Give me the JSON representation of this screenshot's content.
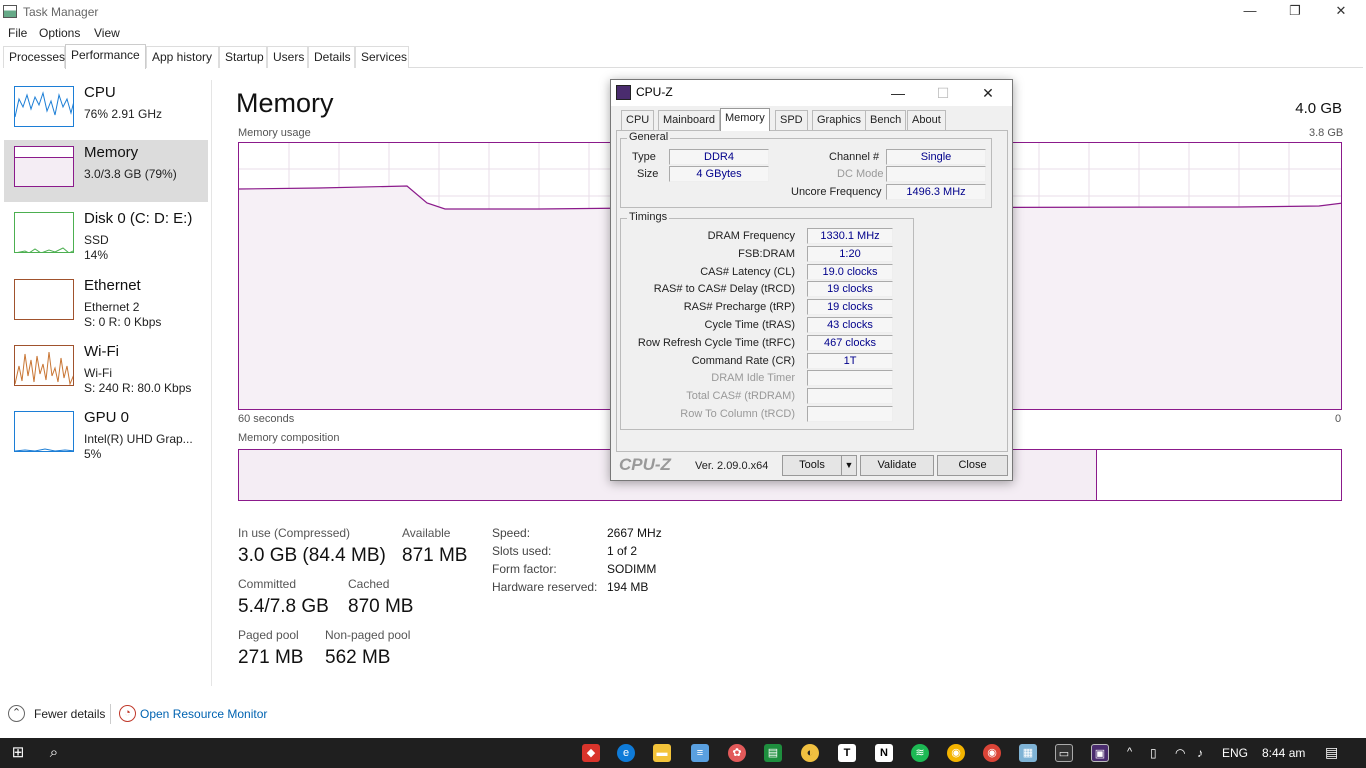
{
  "window": {
    "title": "Task Manager",
    "min": "—",
    "max": "❐",
    "close": "✕"
  },
  "menu": [
    "File",
    "Options",
    "View"
  ],
  "tabs": [
    "Processes",
    "Performance",
    "App history",
    "Startup",
    "Users",
    "Details",
    "Services"
  ],
  "sidebar": [
    {
      "name": "CPU",
      "sub1": "76%  2.91 GHz",
      "sub2": "",
      "sub3": "",
      "color": "#1c7ed6"
    },
    {
      "name": "Memory",
      "sub1": "3.0/3.8 GB (79%)",
      "sub2": "",
      "sub3": "",
      "color": "#8b1a8b"
    },
    {
      "name": "Disk 0 (C: D: E:)",
      "sub1": "SSD",
      "sub2": "14%",
      "sub3": "",
      "color": "#4caf50"
    },
    {
      "name": "Ethernet",
      "sub1": "Ethernet 2",
      "sub2": "S: 0 R: 0 Kbps",
      "sub3": "",
      "color": "#a0522d"
    },
    {
      "name": "Wi-Fi",
      "sub1": "Wi-Fi",
      "sub2": "S: 240 R: 80.0 Kbps",
      "sub3": "",
      "color": "#a0522d"
    },
    {
      "name": "GPU 0",
      "sub1": "Intel(R) UHD Grap...",
      "sub2": "5%",
      "sub3": "",
      "color": "#1c7ed6"
    }
  ],
  "main": {
    "title": "Memory",
    "total": "4.0 GB",
    "usage_label": "Memory usage",
    "usage_max": "3.8 GB",
    "time_label": "60 seconds",
    "zero": "0",
    "composition_label": "Memory composition",
    "stats": {
      "in_use_label": "In use (Compressed)",
      "in_use": "3.0 GB (84.4 MB)",
      "available_label": "Available",
      "available": "871 MB",
      "committed_label": "Committed",
      "committed": "5.4/7.8 GB",
      "cached_label": "Cached",
      "cached": "870 MB",
      "paged_label": "Paged pool",
      "paged": "271 MB",
      "nonpaged_label": "Non-paged pool",
      "nonpaged": "562 MB"
    },
    "details": [
      {
        "label": "Speed:",
        "value": "2667 MHz"
      },
      {
        "label": "Slots used:",
        "value": "1 of 2"
      },
      {
        "label": "Form factor:",
        "value": "SODIMM"
      },
      {
        "label": "Hardware reserved:",
        "value": "194 MB"
      }
    ]
  },
  "footer": {
    "fewer": "Fewer details",
    "resmon": "Open Resource Monitor"
  },
  "cpuz": {
    "title": "CPU-Z",
    "tabs": [
      "CPU",
      "Mainboard",
      "Memory",
      "SPD",
      "Graphics",
      "Bench",
      "About"
    ],
    "general_title": "General",
    "type_label": "Type",
    "type": "DDR4",
    "size_label": "Size",
    "size": "4 GBytes",
    "channel_label": "Channel #",
    "channel": "Single",
    "dcmode_label": "DC Mode",
    "dcmode": "",
    "uncore_label": "Uncore Frequency",
    "uncore": "1496.3 MHz",
    "timings_title": "Timings",
    "timings": [
      {
        "label": "DRAM Frequency",
        "value": "1330.1 MHz",
        "dim": false
      },
      {
        "label": "FSB:DRAM",
        "value": "1:20",
        "dim": false
      },
      {
        "label": "CAS# Latency (CL)",
        "value": "19.0 clocks",
        "dim": false
      },
      {
        "label": "RAS# to CAS# Delay (tRCD)",
        "value": "19 clocks",
        "dim": false
      },
      {
        "label": "RAS# Precharge (tRP)",
        "value": "19 clocks",
        "dim": false
      },
      {
        "label": "Cycle Time (tRAS)",
        "value": "43 clocks",
        "dim": false
      },
      {
        "label": "Row Refresh Cycle Time (tRFC)",
        "value": "467 clocks",
        "dim": false
      },
      {
        "label": "Command Rate (CR)",
        "value": "1T",
        "dim": false
      },
      {
        "label": "DRAM Idle Timer",
        "value": "",
        "dim": true
      },
      {
        "label": "Total CAS# (tRDRAM)",
        "value": "",
        "dim": true
      },
      {
        "label": "Row To Column (tRCD)",
        "value": "",
        "dim": true
      }
    ],
    "logo": "CPU-Z",
    "version": "Ver. 2.09.0.x64",
    "tools": "Tools",
    "validate": "Validate",
    "close": "Close"
  },
  "taskbar": {
    "lang": "ENG",
    "time": "8:44 am"
  }
}
